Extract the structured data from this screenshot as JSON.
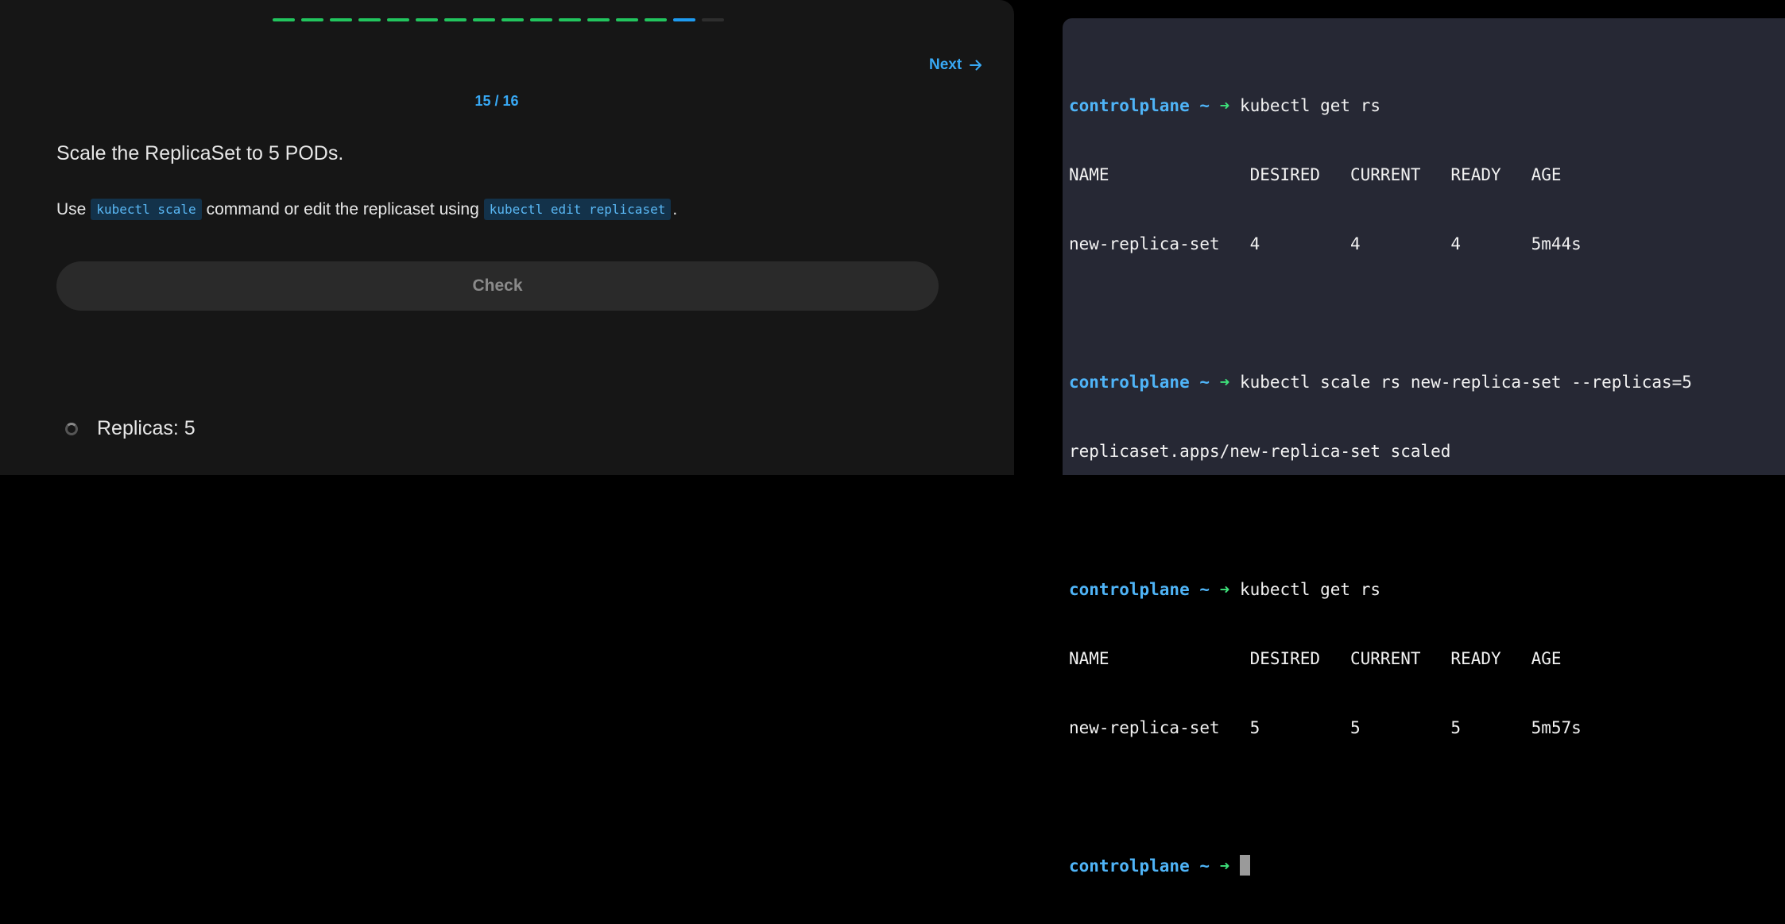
{
  "progress": {
    "completed": 14,
    "current": 15,
    "total": 16
  },
  "lesson": {
    "next_label": "Next",
    "counter": "15 / 16",
    "question": "Scale the ReplicaSet to 5 PODs.",
    "hint": {
      "part1": "Use",
      "code1": "kubectl scale",
      "part2": "command or edit the replicaset using",
      "code2": "kubectl edit replicaset",
      "part3": "."
    },
    "check_label": "Check",
    "task_label": "Replicas: 5"
  },
  "terminal": {
    "prompt_host": "controlplane ~",
    "prompt_arrow": "➜",
    "cmd1": "kubectl get rs",
    "out1_header": "NAME              DESIRED   CURRENT   READY   AGE",
    "out1_row": "new-replica-set   4         4         4       5m44s",
    "cmd2": "kubectl scale rs new-replica-set --replicas=5",
    "out2": "replicaset.apps/new-replica-set scaled",
    "cmd3": "kubectl get rs",
    "out3_header": "NAME              DESIRED   CURRENT   READY   AGE",
    "out3_row": "new-replica-set   5         5         5       5m57s"
  },
  "colors": {
    "accent": "#38a9f5",
    "success": "#22c55e",
    "terminal_bg": "#262834",
    "panel_bg": "#161616"
  }
}
